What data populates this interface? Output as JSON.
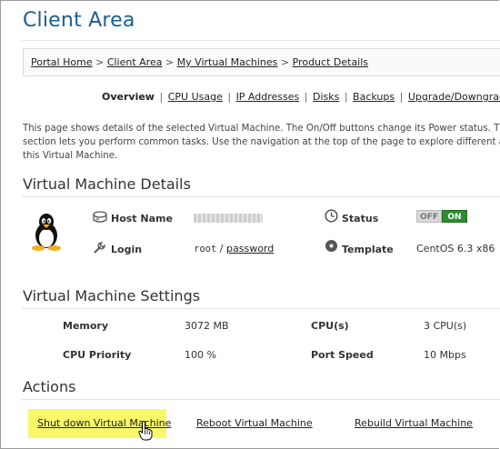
{
  "page": {
    "title": "Client Area"
  },
  "breadcrumb": {
    "items": [
      "Portal Home",
      "Client Area",
      "My Virtual Machines",
      "Product Details"
    ],
    "separator": ">"
  },
  "subnav": {
    "active": "Overview",
    "links": [
      "CPU Usage",
      "IP Addresses",
      "Disks",
      "Backups",
      "Upgrade/Downgrade"
    ],
    "separator": "|"
  },
  "description": {
    "lines": [
      "This page shows details of the selected Virtual Machine. The On/Off buttons change its Power status. The Action",
      "section lets you perform common tasks. Use the navigation at the top of the page to explore different aspects o",
      "this Virtual Machine."
    ]
  },
  "details": {
    "heading": "Virtual Machine Details",
    "host_label": "Host Name",
    "login_label": "Login",
    "login_user": "root",
    "login_sep": "/",
    "password_link": "password",
    "status_label": "Status",
    "status_off": "OFF",
    "status_on": "ON",
    "template_label": "Template",
    "template_value": "CentOS 6.3 x86"
  },
  "settings": {
    "heading": "Virtual Machine Settings",
    "memory_label": "Memory",
    "memory_value": "3072 MB",
    "cpus_label": "CPU(s)",
    "cpus_value": "3 CPU(s)",
    "priority_label": "CPU Priority",
    "priority_value": "100 %",
    "port_label": "Port Speed",
    "port_value": "10 Mbps"
  },
  "actions": {
    "heading": "Actions",
    "shutdown": "Shut down Virtual Machine",
    "reboot": "Reboot Virtual Machine",
    "rebuild": "Rebuild Virtual Machine"
  },
  "colors": {
    "title_blue": "#1a5f8f",
    "highlight_yellow": "#f8f86a",
    "on_green": "#2e8b2e",
    "off_grey": "#d8d8d8"
  },
  "icons": {
    "os": "linux-tux-icon",
    "host": "server-icon",
    "login": "wrench-icon",
    "status": "clock-icon",
    "template": "disc-icon",
    "cursor": "hand-pointer-icon"
  }
}
